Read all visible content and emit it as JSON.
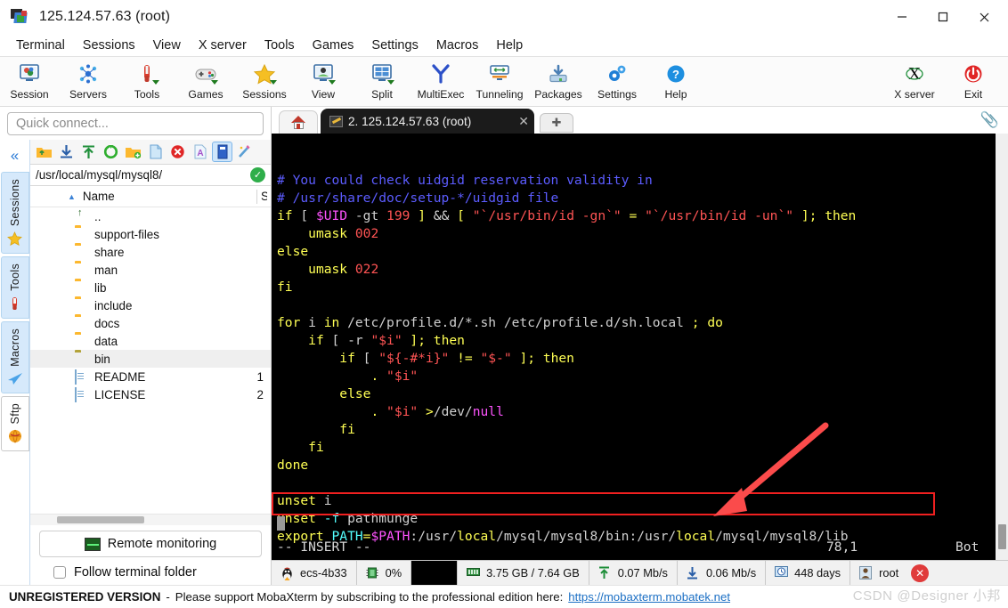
{
  "window": {
    "title": "125.124.57.63 (root)",
    "icon": "mobaxterm-icon",
    "controls": {
      "minimize": "—",
      "maximize": "□",
      "close": "✕"
    }
  },
  "menubar": {
    "items": [
      {
        "label": "Terminal"
      },
      {
        "label": "Sessions"
      },
      {
        "label": "View"
      },
      {
        "label": "X server"
      },
      {
        "label": "Tools"
      },
      {
        "label": "Games"
      },
      {
        "label": "Settings"
      },
      {
        "label": "Macros"
      },
      {
        "label": "Help"
      }
    ]
  },
  "toolbar": {
    "buttons": [
      {
        "label": "Session",
        "icon": "session-icon"
      },
      {
        "label": "Servers",
        "icon": "servers-icon"
      },
      {
        "label": "Tools",
        "icon": "tools-icon"
      },
      {
        "label": "Games",
        "icon": "games-icon"
      },
      {
        "label": "Sessions",
        "icon": "sessions-star-icon"
      },
      {
        "label": "View",
        "icon": "view-icon"
      },
      {
        "label": "Split",
        "icon": "split-icon"
      },
      {
        "label": "MultiExec",
        "icon": "multiexec-icon"
      },
      {
        "label": "Tunneling",
        "icon": "tunneling-icon"
      },
      {
        "label": "Packages",
        "icon": "packages-icon"
      },
      {
        "label": "Settings",
        "icon": "settings-gear-icon"
      },
      {
        "label": "Help",
        "icon": "help-question-icon"
      }
    ],
    "right_buttons": [
      {
        "label": "X server",
        "icon": "x-server-icon"
      },
      {
        "label": "Exit",
        "icon": "power-exit-icon"
      }
    ]
  },
  "sidebar": {
    "quick_connect_placeholder": "Quick connect...",
    "collapse_icon": "chevron-double-left-icon",
    "tabs": [
      {
        "label": "Sessions",
        "icon": "star-icon",
        "active": false
      },
      {
        "label": "Tools",
        "icon": "swiss-knife-icon",
        "active": false
      },
      {
        "label": "Macros",
        "icon": "paper-plane-icon",
        "active": false
      },
      {
        "label": "Sftp",
        "icon": "globe-icon",
        "active": true
      }
    ],
    "remote_monitoring_label": "Remote monitoring",
    "follow_terminal_label": "Follow terminal folder",
    "follow_terminal_checked": false
  },
  "file_browser": {
    "toolbar_icons": [
      "go-up-folder-icon",
      "download-icon",
      "upload-icon",
      "refresh-icon",
      "new-folder-icon",
      "new-file-icon",
      "delete-icon",
      "text-mode-icon",
      "binary-mode-icon",
      "edit-wand-icon"
    ],
    "path": "/usr/local/mysql/mysql8/",
    "path_status_icon": "check-ok-icon",
    "columns": [
      "Name",
      "S"
    ],
    "sort_arrow": "▲",
    "rows": [
      {
        "name": "..",
        "type": "up",
        "size": ""
      },
      {
        "name": "support-files",
        "type": "folder",
        "size": ""
      },
      {
        "name": "share",
        "type": "folder",
        "size": ""
      },
      {
        "name": "man",
        "type": "folder",
        "size": ""
      },
      {
        "name": "lib",
        "type": "folder",
        "size": ""
      },
      {
        "name": "include",
        "type": "folder",
        "size": ""
      },
      {
        "name": "docs",
        "type": "folder",
        "size": ""
      },
      {
        "name": "data",
        "type": "folder",
        "size": ""
      },
      {
        "name": "bin",
        "type": "folder-olive",
        "size": "",
        "selected": true
      },
      {
        "name": "README",
        "type": "file",
        "size": "1"
      },
      {
        "name": "LICENSE",
        "type": "file",
        "size": "2"
      }
    ]
  },
  "tabs": {
    "home_icon": "home-icon",
    "active_tab": "2. 125.124.57.63 (root)",
    "active_tab_icon": "terminal-pen-icon",
    "close_icon": "✕",
    "new_tab_icon": "✚",
    "clip_icon": "paperclip-icon"
  },
  "terminal": {
    "lines": [
      [
        {
          "t": "# You could check uidgid reservation validity in",
          "c": "com"
        }
      ],
      [
        {
          "t": "# /usr/share/doc/setup-*/uidgid file",
          "c": "com"
        }
      ],
      [
        {
          "t": "if",
          "c": "key"
        },
        {
          "t": " [ ",
          "c": "plain"
        },
        {
          "t": "$UID",
          "c": "var"
        },
        {
          "t": " ",
          "c": "plain"
        },
        {
          "t": "-gt",
          "c": "plain"
        },
        {
          "t": " ",
          "c": "plain"
        },
        {
          "t": "199",
          "c": "num"
        },
        {
          "t": " ",
          "c": "plain"
        },
        {
          "t": "]",
          "c": "key"
        },
        {
          "t": " ",
          "c": "plain"
        },
        {
          "t": "&&",
          "c": "white"
        },
        {
          "t": " ",
          "c": "plain"
        },
        {
          "t": "[",
          "c": "key"
        },
        {
          "t": " ",
          "c": "plain"
        },
        {
          "t": "\"`/usr/bin/id -gn`\"",
          "c": "str"
        },
        {
          "t": " ",
          "c": "plain"
        },
        {
          "t": "=",
          "c": "key"
        },
        {
          "t": " ",
          "c": "plain"
        },
        {
          "t": "\"`/usr/bin/id -un`\"",
          "c": "str"
        },
        {
          "t": " ",
          "c": "plain"
        },
        {
          "t": "];",
          "c": "key"
        },
        {
          "t": " ",
          "c": "plain"
        },
        {
          "t": "then",
          "c": "key"
        }
      ],
      [
        {
          "t": "    ",
          "c": "plain"
        },
        {
          "t": "umask",
          "c": "key"
        },
        {
          "t": " ",
          "c": "plain"
        },
        {
          "t": "002",
          "c": "num"
        }
      ],
      [
        {
          "t": "else",
          "c": "key"
        }
      ],
      [
        {
          "t": "    ",
          "c": "plain"
        },
        {
          "t": "umask",
          "c": "key"
        },
        {
          "t": " ",
          "c": "plain"
        },
        {
          "t": "022",
          "c": "num"
        }
      ],
      [
        {
          "t": "fi",
          "c": "key"
        }
      ],
      [
        {
          "t": "",
          "c": "plain"
        }
      ],
      [
        {
          "t": "for",
          "c": "key"
        },
        {
          "t": " ",
          "c": "plain"
        },
        {
          "t": "i",
          "c": "plain"
        },
        {
          "t": " ",
          "c": "plain"
        },
        {
          "t": "in",
          "c": "key"
        },
        {
          "t": " /etc/profile.d/*.sh /etc/profile.d/sh.local ",
          "c": "plain"
        },
        {
          "t": ";",
          "c": "key"
        },
        {
          "t": " ",
          "c": "plain"
        },
        {
          "t": "do",
          "c": "key"
        }
      ],
      [
        {
          "t": "    ",
          "c": "plain"
        },
        {
          "t": "if",
          "c": "key"
        },
        {
          "t": " [ ",
          "c": "plain"
        },
        {
          "t": "-r",
          "c": "plain"
        },
        {
          "t": " ",
          "c": "plain"
        },
        {
          "t": "\"$i\"",
          "c": "str"
        },
        {
          "t": " ",
          "c": "plain"
        },
        {
          "t": "];",
          "c": "key"
        },
        {
          "t": " ",
          "c": "plain"
        },
        {
          "t": "then",
          "c": "key"
        }
      ],
      [
        {
          "t": "        ",
          "c": "plain"
        },
        {
          "t": "if",
          "c": "key"
        },
        {
          "t": " [ ",
          "c": "plain"
        },
        {
          "t": "\"${-#*i}\"",
          "c": "str"
        },
        {
          "t": " ",
          "c": "plain"
        },
        {
          "t": "!=",
          "c": "key"
        },
        {
          "t": " ",
          "c": "plain"
        },
        {
          "t": "\"$-\"",
          "c": "str"
        },
        {
          "t": " ",
          "c": "plain"
        },
        {
          "t": "];",
          "c": "key"
        },
        {
          "t": " ",
          "c": "plain"
        },
        {
          "t": "then",
          "c": "key"
        }
      ],
      [
        {
          "t": "            ",
          "c": "plain"
        },
        {
          "t": ".",
          "c": "key"
        },
        {
          "t": " ",
          "c": "plain"
        },
        {
          "t": "\"$i\"",
          "c": "str"
        }
      ],
      [
        {
          "t": "        ",
          "c": "plain"
        },
        {
          "t": "else",
          "c": "key"
        }
      ],
      [
        {
          "t": "            ",
          "c": "plain"
        },
        {
          "t": ".",
          "c": "key"
        },
        {
          "t": " ",
          "c": "plain"
        },
        {
          "t": "\"$i\"",
          "c": "str"
        },
        {
          "t": " ",
          "c": "plain"
        },
        {
          "t": ">",
          "c": "key"
        },
        {
          "t": "/dev/",
          "c": "plain"
        },
        {
          "t": "null",
          "c": "var"
        }
      ],
      [
        {
          "t": "        ",
          "c": "plain"
        },
        {
          "t": "fi",
          "c": "key"
        }
      ],
      [
        {
          "t": "    ",
          "c": "plain"
        },
        {
          "t": "fi",
          "c": "key"
        }
      ],
      [
        {
          "t": "done",
          "c": "key"
        }
      ],
      [
        {
          "t": "",
          "c": "plain"
        }
      ],
      [
        {
          "t": "unset",
          "c": "key"
        },
        {
          "t": " ",
          "c": "plain"
        },
        {
          "t": "i",
          "c": "plain"
        }
      ],
      [
        {
          "t": "unset",
          "c": "key"
        },
        {
          "t": " ",
          "c": "plain"
        },
        {
          "t": "-f",
          "c": "cyan"
        },
        {
          "t": " ",
          "c": "plain"
        },
        {
          "t": "pathmunge",
          "c": "plain"
        }
      ],
      [
        {
          "t": "export",
          "c": "key"
        },
        {
          "t": " ",
          "c": "plain"
        },
        {
          "t": "PATH",
          "c": "cyan"
        },
        {
          "t": "=",
          "c": "key"
        },
        {
          "t": "$PATH",
          "c": "var"
        },
        {
          "t": ":",
          "c": "plain"
        },
        {
          "t": "/usr/",
          "c": "plain"
        },
        {
          "t": "local",
          "c": "key"
        },
        {
          "t": "/mysql/mysql8/bin:/usr/",
          "c": "plain"
        },
        {
          "t": "local",
          "c": "key"
        },
        {
          "t": "/mysql/mysql8/lib",
          "c": "plain"
        }
      ]
    ],
    "status_mode": "-- INSERT --",
    "status_position": "78,1",
    "status_location": "Bot",
    "highlight_color": "#f02020",
    "arrow_color": "#fb4b4b"
  },
  "session_status": {
    "items": [
      {
        "label": "ecs-4b33",
        "icon": "linux-penguin-icon"
      },
      {
        "label": "0%",
        "icon": "cpu-icon"
      },
      {
        "label": "",
        "icon": "graph-black-icon"
      },
      {
        "label": "3.75 GB / 7.64 GB",
        "icon": "memory-icon"
      },
      {
        "label": "0.07 Mb/s",
        "icon": "upload-arrow-icon"
      },
      {
        "label": "0.06 Mb/s",
        "icon": "download-arrow-icon"
      },
      {
        "label": "448 days",
        "icon": "uptime-clock-icon"
      },
      {
        "label": "root",
        "icon": "user-icon"
      }
    ],
    "close_icon": "✕"
  },
  "footer": {
    "badge": "UNREGISTERED VERSION",
    "separator": "-",
    "message": "Please support MobaXterm by subscribing to the professional edition here:",
    "link": "https://mobaxterm.mobatek.net",
    "watermark": "CSDN @Designer 小邦"
  }
}
